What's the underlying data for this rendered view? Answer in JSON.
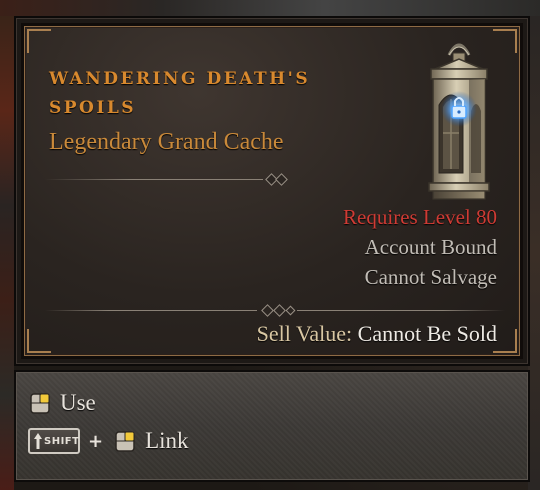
{
  "item": {
    "name": "Wandering Death's Spoils",
    "type": "Legendary Grand Cache",
    "icon": "lantern-cache-icon",
    "stats": {
      "requirement": "Requires Level 80",
      "bound": "Account Bound",
      "salvage": "Cannot Salvage"
    },
    "sell": {
      "label": "Sell Value:",
      "value": "Cannot Be Sold"
    }
  },
  "actions": {
    "use_label": "Use",
    "shift_key": "SHIFT",
    "plus": "+",
    "link_label": "Link"
  },
  "colors": {
    "item_name": "#d8892e",
    "item_type": "#c9893a",
    "requirement": "#cf3b34",
    "neutral_stat": "#c2bdb6",
    "sell_label": "#d9c7a3",
    "sell_value": "#eeeae4",
    "lock_glow": "#4fa3ff"
  }
}
